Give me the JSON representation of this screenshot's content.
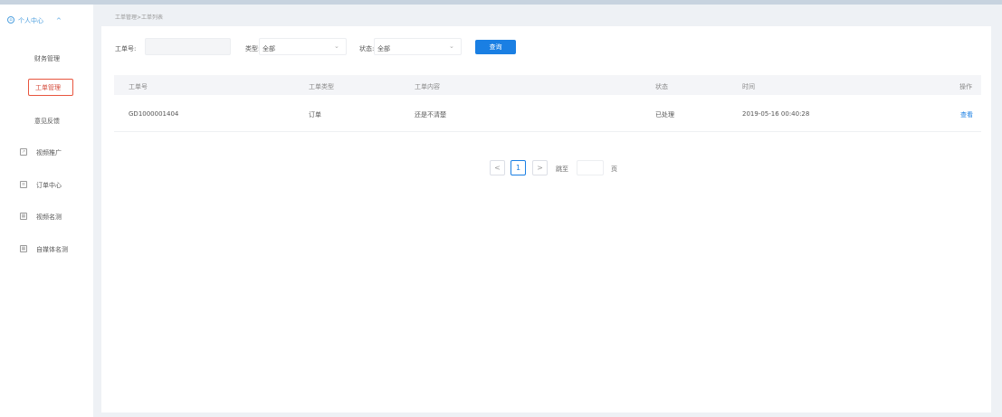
{
  "sidebar": {
    "header_label": "个人中心",
    "header_chevron": "^",
    "items": [
      {
        "label": "财务管理"
      },
      {
        "label": "工单管理"
      },
      {
        "label": "意见反馈"
      },
      {
        "label": "视频推广",
        "icon": "external-link-icon"
      },
      {
        "label": "订单中心",
        "icon": "list-icon"
      },
      {
        "label": "视频名测",
        "icon": "image-icon"
      },
      {
        "label": "自媒体名测",
        "icon": "image-icon"
      }
    ]
  },
  "breadcrumb": "工单管理>工单列表",
  "filters": {
    "order_no_label": "工单号:",
    "order_no_value": "",
    "type_label": "类型:",
    "type_value": "全部",
    "status_label": "状态:",
    "status_value": "全部",
    "query_label": "查询"
  },
  "table": {
    "headers": [
      "工单号",
      "工单类型",
      "工单内容",
      "状态",
      "时间",
      "操作"
    ],
    "rows": [
      [
        "GD1000001404",
        "订单",
        "还是不清楚",
        "已处理",
        "2019-05-16 00:40:28",
        "查看"
      ]
    ]
  },
  "pagination": {
    "prev": "<",
    "current": "1",
    "next": ">",
    "goto_label": "跳至",
    "page_suffix": "页"
  },
  "colors": {
    "accent": "#1a7fe3",
    "active_border": "#e8553e",
    "sidebar_head": "#4fa0df"
  }
}
